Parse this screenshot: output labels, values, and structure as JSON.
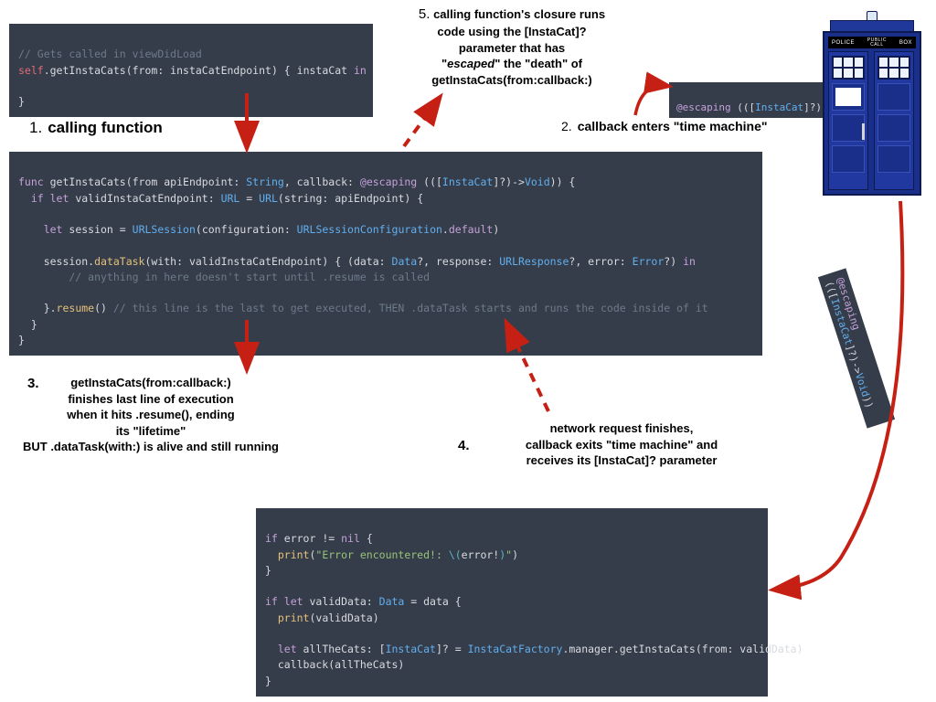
{
  "steps": {
    "s1": {
      "num": "1.",
      "title": "calling function"
    },
    "s2": {
      "num": "2.",
      "title": "callback enters \"time machine\""
    },
    "s3": {
      "num": "3.",
      "title": "getInstaCats(from:callback:)\nfinishes last line of execution\nwhen it hits .resume(), ending\nits \"lifetime\"\nBUT .dataTask(with:) is alive and still running"
    },
    "s4": {
      "num": "4.",
      "title": "network request finishes,\ncallback exits \"time machine\" and\nreceives its [InstaCat]? parameter"
    },
    "s5": {
      "num": "5.",
      "title": "calling function's closure runs\ncode using the [InstaCat]?\nparameter that has\n\"escaped\" the \"death\" of\ngetInstaCats(from:callback:)"
    }
  },
  "tardis": {
    "left": "POLICE",
    "mid1": "PUBLIC",
    "mid2": "CALL",
    "right": "BOX"
  },
  "small_esc": "@escaping (([InstaCat]?)->Void))",
  "rot_esc": "@escaping (([InstaCat]?)->Void))",
  "code1": {
    "l1": "// Gets called in viewDidLoad",
    "l2a": "self",
    "l2b": ".getInstaCats(from: instaCatEndpoint) { instaCat ",
    "l2c": "in",
    "l3": "",
    "l4": "}"
  },
  "code2": {
    "l1a": "func",
    "l1b": " getInstaCats(from apiEndpoint: ",
    "l1c": "String",
    "l1d": ", callback: ",
    "l1e": "@escaping",
    "l1f": " (([",
    "l1g": "InstaCat",
    "l1h": "]?)->",
    "l1i": "Void",
    "l1j": ")) {",
    "l2a": "  if",
    "l2b": " let",
    "l2c": " validInstaCatEndpoint: ",
    "l2d": "URL",
    "l2e": " = ",
    "l2f": "URL",
    "l2g": "(string: apiEndpoint) {",
    "l3": "",
    "l4a": "    let",
    "l4b": " session = ",
    "l4c": "URLSession",
    "l4d": "(configuration: ",
    "l4e": "URLSessionConfiguration",
    "l4f": ".",
    "l4g": "default",
    "l4h": ")",
    "l5": "",
    "l6a": "    session.",
    "l6b": "dataTask",
    "l6c": "(with: validInstaCatEndpoint) { (data: ",
    "l6d": "Data",
    "l6e": "?, response: ",
    "l6f": "URLResponse",
    "l6g": "?, error: ",
    "l6h": "Error",
    "l6i": "?) ",
    "l6j": "in",
    "l7": "        // anything in here doesn't start until .resume is called",
    "l8": "",
    "l9a": "    }.",
    "l9b": "resume",
    "l9c": "() ",
    "l9d": "// this line is the last to get executed, THEN .dataTask starts and runs the code inside of it",
    "l10": "  }",
    "l11": "}"
  },
  "code3": {
    "l1a": "if",
    "l1b": " error != ",
    "l1c": "nil",
    "l1d": " {",
    "l2a": "  print",
    "l2b": "(",
    "l2c": "\"Error encountered!: ",
    "l2d": "\\(",
    "l2e": "error!",
    "l2f": ")",
    "l2g": "\"",
    "l2h": ")",
    "l3": "}",
    "l4": "",
    "l5a": "if",
    "l5b": " let",
    "l5c": " validData: ",
    "l5d": "Data",
    "l5e": " = data {",
    "l6a": "  print",
    "l6b": "(validData)",
    "l7": "",
    "l8a": "  let",
    "l8b": " allTheCats: [",
    "l8c": "InstaCat",
    "l8d": "]? = ",
    "l8e": "InstaCatFactory",
    "l8f": ".manager.getInstaCats(from: validData)",
    "l9": "  callback(allTheCats)",
    "l10": "}"
  }
}
